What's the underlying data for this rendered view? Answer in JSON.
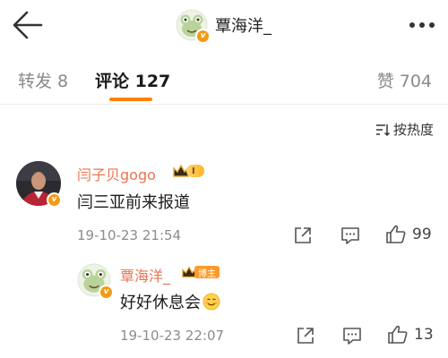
{
  "header": {
    "title": "覃海洋_",
    "icons": {
      "back": "back-arrow-icon",
      "more": "more-dots-icon"
    }
  },
  "tabs": {
    "repost_label": "转发 8",
    "comments_label": "评论 127",
    "likes_label": "赞 704",
    "active": "comments",
    "accent_color": "#ff8200"
  },
  "sort": {
    "label": "按热度",
    "icon": "sort-icon"
  },
  "comments": [
    {
      "name": "闫子贝gogo",
      "badge_level": "I",
      "text": "闫三亚前来报道",
      "time": "19-10-23 21:54",
      "likes": "99",
      "name_color": "#eb7350"
    }
  ],
  "reply": {
    "name": "覃海洋_",
    "badge_label": "博主",
    "text": "好好休息会",
    "emoji": "smiling-face-icon",
    "time": "19-10-23 22:07",
    "likes": "13"
  }
}
